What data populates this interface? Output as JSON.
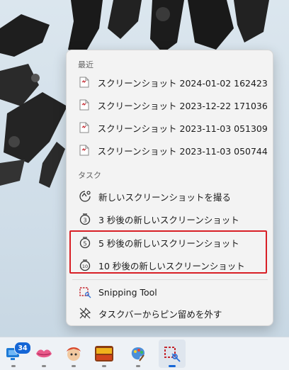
{
  "menu": {
    "recent_header": "最近",
    "recent_items": [
      {
        "label": "スクリーンショット 2024-01-02 162423...."
      },
      {
        "label": "スクリーンショット 2023-12-22 171036...."
      },
      {
        "label": "スクリーンショット 2023-11-03 051309...."
      },
      {
        "label": "スクリーンショット 2023-11-03 050744...."
      }
    ],
    "tasks_header": "タスク",
    "task_items": [
      {
        "label": "新しいスクリーンショットを撮る",
        "icon": "snip-new-icon"
      },
      {
        "label": "3 秒後の新しいスクリーンショット",
        "icon": "timer-3-icon"
      },
      {
        "label": "5 秒後の新しいスクリーンショット",
        "icon": "timer-5-icon"
      },
      {
        "label": "10 秒後の新しいスクリーンショット",
        "icon": "timer-10-icon"
      }
    ],
    "app_item": {
      "label": "Snipping Tool",
      "icon": "snipping-tool-icon"
    },
    "unpin_item": {
      "label": "タスクバーからピン留めを外す",
      "icon": "unpin-icon"
    }
  },
  "taskbar": {
    "badge_count": "34",
    "apps": [
      "remote-desktop-icon",
      "lips-app-icon",
      "game-avatar-icon",
      "game-title-icon",
      "paint-icon",
      "snipping-tool-icon"
    ]
  },
  "colors": {
    "highlight": "#d81f26",
    "badge": "#1566d6",
    "snip_accent": "#c4262e"
  }
}
